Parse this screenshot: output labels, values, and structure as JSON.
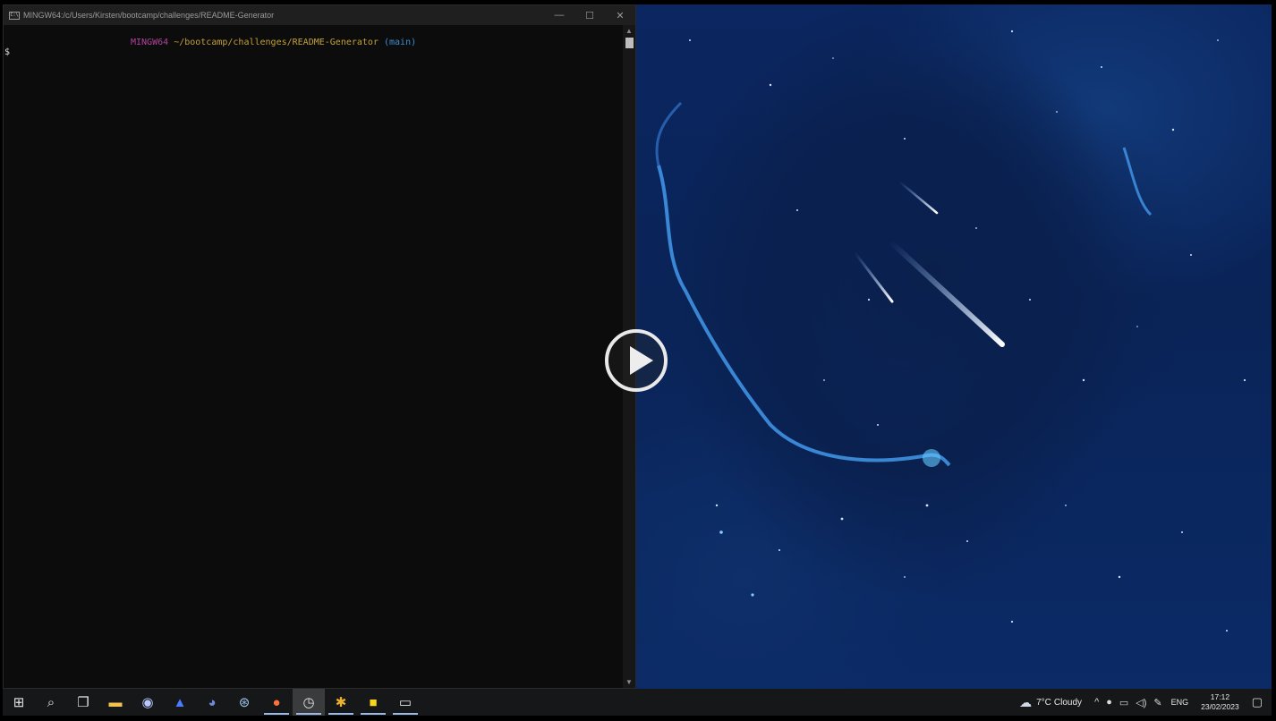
{
  "terminal": {
    "title": "MINGW64:/c/Users/Kirsten/bootcamp/challenges/README-Generator",
    "prompt_host": "MINGW64",
    "prompt_path": "~/bootcamp/challenges/README-Generator",
    "prompt_branch": "(main)",
    "prompt_symbol": "$",
    "controls": {
      "minimize": "—",
      "maximize": "☐",
      "close": "✕"
    }
  },
  "taskbar": {
    "apps": [
      {
        "name": "start-button",
        "icon": "windows-icon",
        "glyph": "⊞"
      },
      {
        "name": "search-button",
        "icon": "search-icon",
        "glyph": "⌕"
      },
      {
        "name": "task-view-button",
        "icon": "task-view-icon",
        "glyph": "❐"
      },
      {
        "name": "file-explorer-button",
        "icon": "folder-icon",
        "glyph": "▬"
      },
      {
        "name": "vpn-button",
        "icon": "vpn-icon",
        "glyph": "◉"
      },
      {
        "name": "nordvpn-button",
        "icon": "mountain-icon",
        "glyph": "▲"
      },
      {
        "name": "discord-button",
        "icon": "discord-icon",
        "glyph": "◕"
      },
      {
        "name": "steam-button",
        "icon": "steam-icon",
        "glyph": "⊛"
      },
      {
        "name": "firefox-button",
        "icon": "firefox-icon",
        "glyph": "●"
      },
      {
        "name": "clock-app-button",
        "icon": "clock-icon",
        "glyph": "◷"
      },
      {
        "name": "slack-button",
        "icon": "slack-icon",
        "glyph": "✱"
      },
      {
        "name": "sticky-notes-button",
        "icon": "sticky-notes-icon",
        "glyph": "■"
      },
      {
        "name": "terminal-button",
        "icon": "terminal-icon",
        "glyph": "▭"
      }
    ],
    "weather": {
      "icon": "cloud-icon",
      "glyph": "☁",
      "temp": "7°C",
      "condition": "Cloudy"
    },
    "tray_icons": [
      {
        "name": "show-hidden-icons-button",
        "icon": "chevron-up-icon",
        "glyph": "^"
      },
      {
        "name": "microphone-button",
        "icon": "microphone-icon",
        "glyph": "🎙"
      },
      {
        "name": "network-button",
        "icon": "network-icon",
        "glyph": "🖧"
      },
      {
        "name": "volume-button",
        "icon": "speaker-icon",
        "glyph": "🔈"
      },
      {
        "name": "pen-button",
        "icon": "pen-icon",
        "glyph": "✎"
      }
    ],
    "language": "ENG",
    "time": "17:12",
    "date": "23/02/2023",
    "notification_glyph": "🗨"
  },
  "colors": {
    "prompt_host": "#b0439b",
    "prompt_path": "#c2a13a",
    "prompt_branch": "#3e8ed0",
    "terminal_bg": "#0c0c0c",
    "taskbar_bg": "#161718"
  }
}
